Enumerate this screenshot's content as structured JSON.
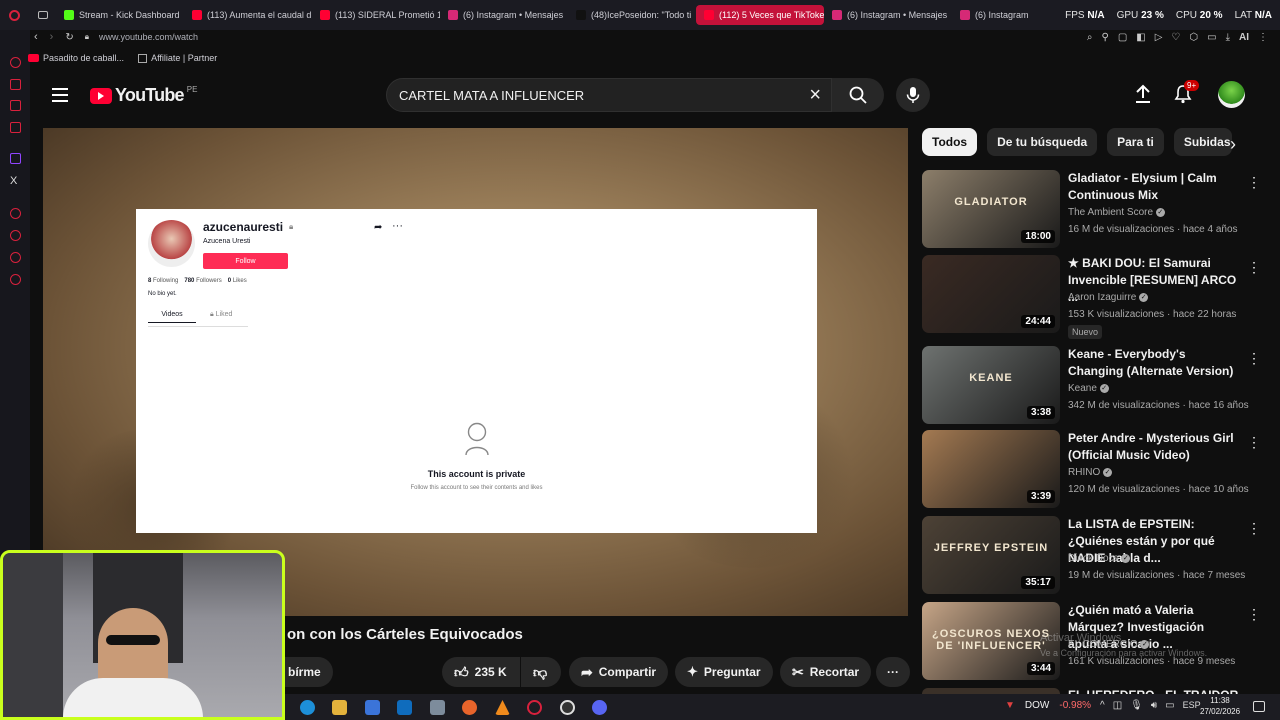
{
  "browser": {
    "tabs": [
      {
        "label": "Stream - Kick Dashboard",
        "color": "#53fc18"
      },
      {
        "label": "(113) Aumenta el caudal d",
        "color": "#ff0033"
      },
      {
        "label": "(113) SIDERAL Prometió 1",
        "color": "#ff0033"
      },
      {
        "label": "(6) Instagram • Mensajes",
        "color": "#d62976"
      },
      {
        "label": "(48)IcePoseidon: \"Todo ti",
        "color": "#111111"
      },
      {
        "label": "(112) 5 Veces que TikToke",
        "color": "#ff0033",
        "active": true
      },
      {
        "label": "(6) Instagram • Mensajes",
        "color": "#d62976"
      },
      {
        "label": "(6) Instagram",
        "color": "#d62976"
      }
    ],
    "hud": {
      "fps_label": "FPS",
      "fps_value": "N/A",
      "gpu_label": "GPU",
      "gpu_value": "23 %",
      "cpu_label": "CPU",
      "cpu_value": "20 %",
      "lat_label": "LAT",
      "lat_value": "N/A"
    },
    "url": "www.youtube.com/watch",
    "bookmarks": [
      "Pasadito de caball...",
      "Affiliate | Partner"
    ],
    "ai_label": "AI"
  },
  "youtube": {
    "logo_text": "YouTube",
    "country": "PE",
    "search_value": "CARTEL MATA A INFLUENCER",
    "notif_badge": "9+",
    "video_title": "on con los Cárteles Equivocados",
    "subscribe_partial": "bírme",
    "likes": "235 K",
    "share_label": "Compartir",
    "ask_label": "Preguntar",
    "clip_label": "Recortar"
  },
  "tiktok": {
    "username": "azucenauresti",
    "display_name": "Azucena Uresti",
    "follow_label": "Follow",
    "following_count": "8",
    "following_label": "Following",
    "followers_count": "780",
    "followers_label": "Followers",
    "likes_count": "0",
    "likes_label": "Likes",
    "bio": "No bio yet.",
    "tab_videos": "Videos",
    "tab_liked": "Liked",
    "private_title": "This account is private",
    "private_sub": "Follow this account to see their contents and likes"
  },
  "sidebar": {
    "chips": [
      "Todos",
      "De tu búsqueda",
      "Para ti",
      "Subidas r"
    ],
    "recs": [
      {
        "title": "Gladiator - Elysium | Calm Continuous Mix",
        "channel": "The Ambient Score",
        "meta": "16 M de visualizaciones · hace 4 años",
        "duration": "18:00",
        "thumb": "#8c7e6a",
        "thumb_text": "GLADIATOR"
      },
      {
        "title": "★ BAKI DOU: El Samurai Invencible [RESUMEN] ARCO ...",
        "channel": "Aaron Izaguirre",
        "meta": "153 K visualizaciones · hace 22 horas",
        "duration": "24:44",
        "thumb": "#3a2a23",
        "badge": "Nuevo"
      },
      {
        "title": "Keane - Everybody's Changing (Alternate Version)",
        "channel": "Keane",
        "meta": "342 M de visualizaciones · hace 16 años",
        "duration": "3:38",
        "thumb": "#6e7270",
        "thumb_text": "KEANE"
      },
      {
        "title": "Peter Andre - Mysterious Girl (Official Music Video)",
        "channel": "RHINO",
        "meta": "120 M de visualizaciones · hace 10 años",
        "duration": "3:39",
        "thumb": "#a47a52"
      },
      {
        "title": "La LISTA de EPSTEIN: ¿Quiénes están y por qué NADIE habla d...",
        "channel": "Dieck Docs",
        "meta": "19 M de visualizaciones · hace 7 meses",
        "duration": "35:17",
        "thumb": "#4d4236",
        "thumb_text": "JEFFREY EPSTEIN"
      },
      {
        "title": "¿Quién mató a Valeria Márquez? Investigación apunta a sicario ...",
        "channel": "EL COMERCIO",
        "meta": "161 K visualizaciones · hace 9 meses",
        "duration": "3:44",
        "thumb": "#c6a587",
        "thumb_text": "¿OSCUROS NEXOS DE 'INFLUENCER'"
      }
    ],
    "next_partial": "EL HEREDERO - EL TRAIDOR"
  },
  "windows": {
    "activate_title": "Activar Windows",
    "activate_sub": "Ve a Configuración para activar Windows.",
    "stock_label": "DOW",
    "stock_change": "-0.98%",
    "lang": "ESP",
    "time": "11:38",
    "date": "27/02/2026"
  }
}
